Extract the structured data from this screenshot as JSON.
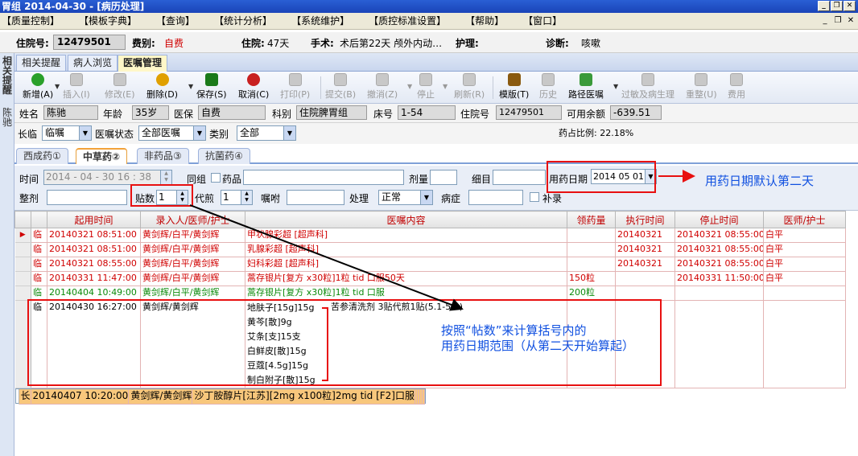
{
  "window": {
    "title": "胃组  2014-04-30 - [病历处理]",
    "btn_minimize": "_",
    "btn_restore": "❐",
    "btn_close": "✕"
  },
  "menu": [
    "【质量控制】",
    "【模板字典】",
    "【查询】",
    "【统计分析】",
    "【系统维护】",
    "【质控标准设置】",
    "【帮助】",
    "【窗口】"
  ],
  "menu_controls": {
    "minimize": "_",
    "restore": "❐",
    "close": "✕"
  },
  "patient": {
    "id_label": "住院号:",
    "id_value": "12479501",
    "category_label": "费别:",
    "category_value": "自费",
    "admit_label": "住院:",
    "admit_value": "47天",
    "surgery_label": "手术:",
    "surgery_value": "术后第22天  颅外内动…",
    "nursing_label": "护理:",
    "nursing_value": "",
    "diagnosis_label": "诊断:",
    "diagnosis_value": "咳嗽"
  },
  "left_strip": {
    "tab1": "相关提醒",
    "tab2": "陈驰"
  },
  "top_tabs": [
    "相关提醒",
    "病人浏览",
    "医嘱管理"
  ],
  "toolbar": [
    {
      "label": "新增(A)",
      "icon": "plus-icon",
      "enabled": true,
      "color": "#2aa02a"
    },
    {
      "label": "插入(I)",
      "icon": "insert-icon",
      "enabled": false
    },
    {
      "label": "修改(E)",
      "icon": "edit-icon",
      "enabled": false
    },
    {
      "label": "删除(D)",
      "icon": "delete-icon",
      "enabled": true,
      "color": "#e0a000"
    },
    {
      "label": "保存(S)",
      "icon": "save-icon",
      "enabled": true,
      "color": "#1a7a1a"
    },
    {
      "label": "取消(C)",
      "icon": "undo-icon",
      "enabled": true,
      "color": "#c82020"
    },
    {
      "label": "打印(P)",
      "icon": "print-icon",
      "enabled": false
    },
    {
      "label": "提交(B)",
      "icon": "submit-icon",
      "enabled": false
    },
    {
      "label": "撤消(Z)",
      "icon": "trash-icon",
      "enabled": false
    },
    {
      "label": "停止",
      "icon": "stop-icon",
      "enabled": false
    },
    {
      "label": "刷新(R)",
      "icon": "refresh-icon",
      "enabled": false
    },
    {
      "label": "模版(T)",
      "icon": "template-icon",
      "enabled": true,
      "color": "#8a5a10"
    },
    {
      "label": "历史",
      "icon": "history-icon",
      "enabled": false
    },
    {
      "label": "路径医嘱",
      "icon": "path-order-icon",
      "enabled": true,
      "color": "#3a9a3a"
    },
    {
      "label": "过敏及病生理",
      "icon": "allergy-icon",
      "enabled": false
    },
    {
      "label": "重整(U)",
      "icon": "reorganize-icon",
      "enabled": false
    },
    {
      "label": "费用",
      "icon": "fee-icon",
      "enabled": false
    }
  ],
  "info": {
    "name_label": "姓名",
    "name": "陈驰",
    "age_label": "年龄",
    "age": "35岁",
    "insurance_label": "医保",
    "insurance": "自费",
    "dept_label": "科别",
    "dept": "住院脾胃组",
    "bed_label": "床号",
    "bed": "1-54",
    "inpatient_label": "住院号",
    "inpatient": "12479501",
    "balance_label": "可用余额",
    "balance": "-639.51"
  },
  "status": {
    "duration_label": "长临",
    "duration_value": "临嘱",
    "order_status_label": "医嘱状态",
    "order_status_value": "全部医嘱",
    "category_label": "类别",
    "category_value": "全部",
    "drug_ratio": "药占比例: 22.18%"
  },
  "sub_tabs": [
    "西成药①",
    "中草药②",
    "非药品③",
    "抗菌药④"
  ],
  "form": {
    "time_label": "时间",
    "time_value": "2014 - 04 - 30   16 : 38",
    "same_group_label": "同组",
    "drug_label": "药品",
    "dose_label": "剂量",
    "detail_label": "细目",
    "med_date_label": "用药日期",
    "med_date_value": "2014 05 01",
    "formula_label": "整剂",
    "packets_label": "贴数",
    "packets_value": "1",
    "decoct_label": "代煎",
    "decoct_value": "1",
    "instruction_label": "嘱咐",
    "process_label": "处理",
    "process_value": "正常",
    "disease_label": "病症",
    "supplement_label": "补录"
  },
  "grid": {
    "columns": [
      "",
      "",
      "起用时间",
      "录入人/医师/护士",
      "医嘱内容",
      "领药量",
      "执行时间",
      "停止时间",
      "医师/护士"
    ],
    "rows": [
      {
        "style": "red",
        "current": true,
        "type": "临",
        "start": "20140321 08:51:00",
        "entry": "黄剑辉/白平/黄剑辉",
        "content": "甲状腺彩超   [超声科]",
        "qty": "",
        "exec": "20140321",
        "stop": "20140321 08:55:00",
        "doctor": "白平"
      },
      {
        "style": "red",
        "type": "临",
        "start": "20140321 08:51:00",
        "entry": "黄剑辉/白平/黄剑辉",
        "content": "乳腺彩超   [超声科]",
        "qty": "",
        "exec": "20140321",
        "stop": "20140321 08:55:00",
        "doctor": "白平"
      },
      {
        "style": "red",
        "type": "临",
        "start": "20140321 08:55:00",
        "entry": "黄剑辉/白平/黄剑辉",
        "content": "妇科彩超   [超声科]",
        "qty": "",
        "exec": "20140321",
        "stop": "20140321 08:55:00",
        "doctor": "白平"
      },
      {
        "style": "red",
        "type": "临",
        "start": "20140331 11:47:00",
        "entry": "黄剑辉/白平/黄剑辉",
        "content": "蒿存银片[复方 x30粒]1粒  tid 口服50天",
        "qty": "150粒",
        "exec": "",
        "stop": "20140331 11:50:00",
        "doctor": "白平"
      },
      {
        "style": "green",
        "type": "临",
        "start": "20140404 10:49:00",
        "entry": "黄剑辉/白平/黄剑辉",
        "content": "蒿存银片[复方 x30粒]1粒  tid 口服",
        "qty": "200粒",
        "exec": "",
        "stop": "",
        "doctor": ""
      }
    ],
    "herbal": {
      "type": "临",
      "start": "20140430 16:27:00",
      "entry": "黄剑辉/黄剑辉",
      "herbs": [
        "地肤子[15g]15g",
        "黄芩[散]9g",
        "艾条[支]15支",
        "白鲜皮[散]15g",
        "豆蔻[4.5g]15g",
        "制白附子[散]15g"
      ],
      "note": "苦参清洗剂 3贴代煎1贴(5.1-5.3)"
    },
    "last_row": {
      "type": "长",
      "start": "20140407 10:20:00",
      "entry": "黄剑辉/黄剑辉",
      "content": "沙丁胺醇片[江苏][2mg x100粒]2mg   tid  [F2]口服"
    }
  },
  "annotations": {
    "date_note": "用药日期默认第二天",
    "packets_note_line1": "按照“帖数”来计算括号内的",
    "packets_note_line2": "用药日期范围（从第二天开始算起）"
  },
  "colors": {
    "title_bar": "#1a44b8",
    "annotation_red": "#e81010",
    "annotation_blue": "#1050e0",
    "selected_row": "#f8c77c",
    "order_red": "#d00000",
    "order_green": "#0a8a0a"
  }
}
